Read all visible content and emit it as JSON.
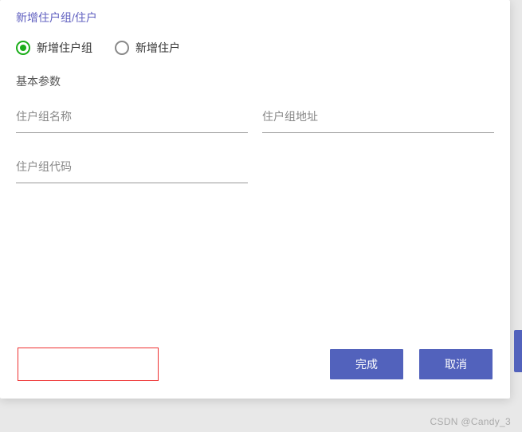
{
  "dialog": {
    "title": "新增住户组/住户",
    "radios": {
      "group": "新增住户组",
      "resident": "新增住户"
    },
    "section_label": "基本参数",
    "fields": {
      "name_placeholder": "住户组名称",
      "address_placeholder": "住户组地址",
      "code_placeholder": "住户组代码"
    },
    "buttons": {
      "confirm": "完成",
      "cancel": "取消"
    }
  },
  "watermark": "CSDN @Candy_3"
}
